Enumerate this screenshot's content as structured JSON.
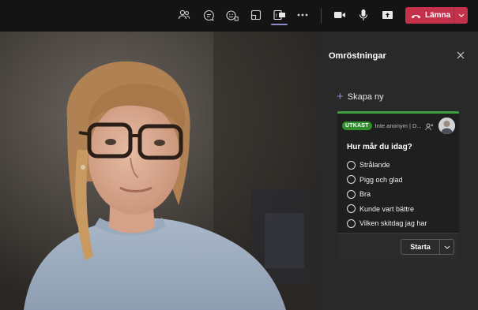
{
  "toolbar": {
    "icons": [
      "people-icon",
      "chat-icon",
      "reactions-icon",
      "rooms-icon",
      "apps-icon",
      "more-icon",
      "camera-icon",
      "mic-icon",
      "share-icon"
    ],
    "active_icon": "apps-icon",
    "leave_label": "Lämna"
  },
  "panel": {
    "title": "Omröstningar",
    "create_new_label": "Skapa ny"
  },
  "poll": {
    "status_badge": "UTKAST",
    "anonymity_text": "Inte anonym | D...",
    "question": "Hur mår du idag?",
    "options": [
      "Strålande",
      "Pigg och glad",
      "Bra",
      "Kunde vart bättre",
      "Vilken skitdag jag har"
    ],
    "start_label": "Starta"
  },
  "colors": {
    "accent": "#8b8cc7",
    "leave": "#c4314b",
    "draft_badge": "#2f8f2f",
    "panel_bg": "#292929",
    "topbar_bg": "#141414"
  }
}
